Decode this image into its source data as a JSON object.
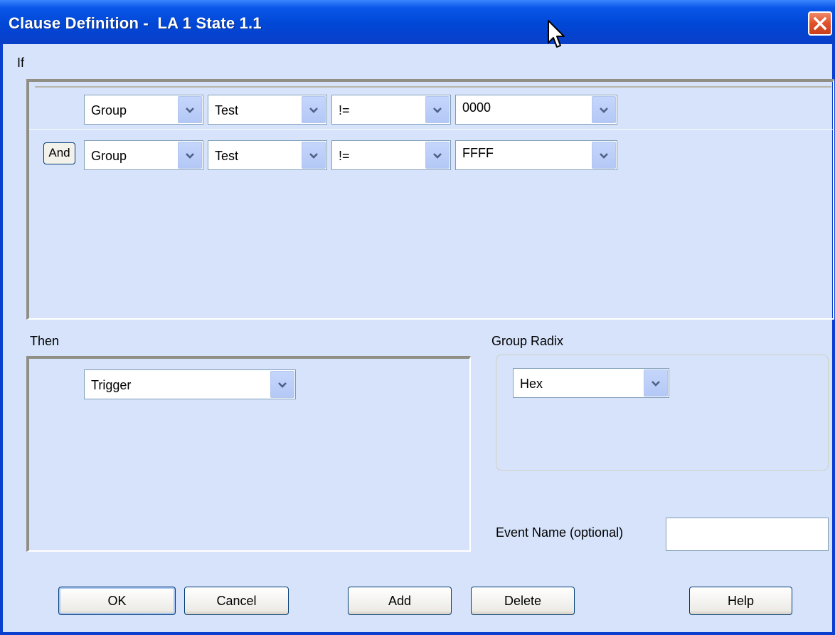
{
  "window": {
    "title": "Clause Definition -  LA 1 State 1.1"
  },
  "if_section": {
    "label": "If",
    "rows": [
      {
        "connector": "",
        "group": "Group",
        "field": "Test",
        "operator": "!=",
        "value": "0000"
      },
      {
        "connector": "And",
        "group": "Group",
        "field": "Test",
        "operator": "!=",
        "value": "FFFF"
      }
    ]
  },
  "then_section": {
    "label": "Then",
    "action": "Trigger"
  },
  "group_radix": {
    "label": "Group Radix",
    "value": "Hex"
  },
  "event_name": {
    "label": "Event Name (optional)",
    "value": ""
  },
  "buttons": {
    "ok": "OK",
    "cancel": "Cancel",
    "add": "Add",
    "delete": "Delete",
    "help": "Help"
  },
  "icons": {
    "close": "close-icon",
    "dropdown": "chevron-down-icon",
    "cursor": "mouse-pointer-icon"
  },
  "colors": {
    "title_bar": "#0a56e8",
    "client_bg": "#d6e3fa",
    "close_button": "#e0502a"
  }
}
